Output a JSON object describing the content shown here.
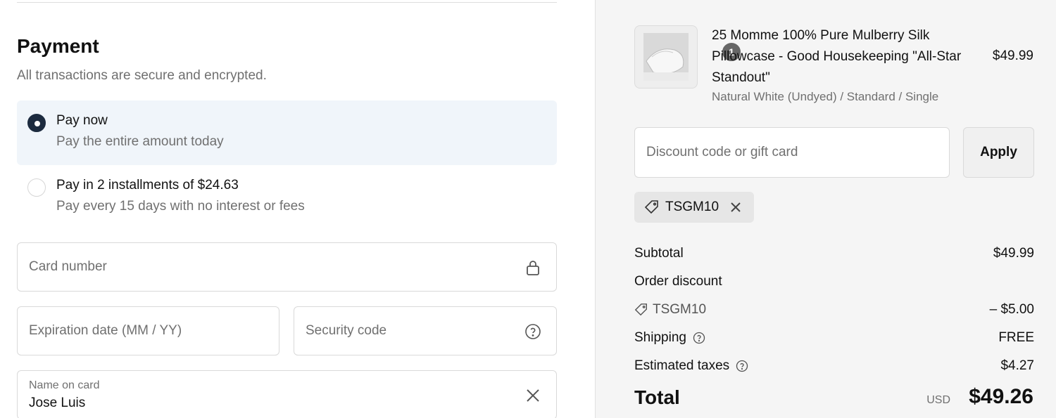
{
  "payment": {
    "title": "Payment",
    "subtitle": "All transactions are secure and encrypted.",
    "options": [
      {
        "title": "Pay now",
        "description": "Pay the entire amount today",
        "selected": true
      },
      {
        "title": "Pay in 2 installments of $24.63",
        "description": "Pay every 15 days with no interest or fees",
        "selected": false
      }
    ],
    "card_number_placeholder": "Card number",
    "expiration_placeholder": "Expiration date (MM / YY)",
    "security_placeholder": "Security code",
    "name_label": "Name on card",
    "name_value": "Jose Luis"
  },
  "summary": {
    "product": {
      "quantity": "1",
      "name": "25 Momme 100% Pure Mulberry Silk Pillowcase - Good Housekeeping \"All-Star Standout\"",
      "variant": "Natural White (Undyed) / Standard / Single",
      "price": "$49.99"
    },
    "discount_placeholder": "Discount code or gift card",
    "apply_label": "Apply",
    "applied_code": "TSGM10",
    "subtotal_label": "Subtotal",
    "subtotal_value": "$49.99",
    "order_discount_label": "Order discount",
    "discount_code": "TSGM10",
    "discount_value": "– $5.00",
    "shipping_label": "Shipping",
    "shipping_value": "FREE",
    "taxes_label": "Estimated taxes",
    "taxes_value": "$4.27",
    "total_label": "Total",
    "currency": "USD",
    "total_value": "$49.26"
  },
  "colors": {
    "accent": "#1c2b3f",
    "selected_bg": "#f0f5fa",
    "summary_bg": "#f5f5f5"
  },
  "icons": [
    "lock-icon",
    "help-circle-icon",
    "close-icon",
    "tag-icon"
  ]
}
